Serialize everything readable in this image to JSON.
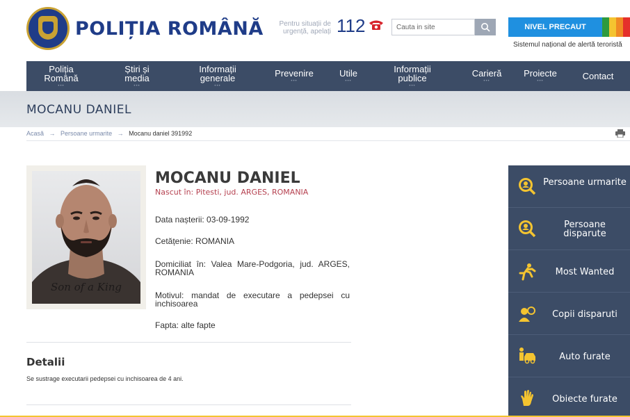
{
  "header": {
    "logo_text": "POLIȚIA ROMÂNĂ",
    "emergency_text": "Pentru situații de urgență, apelați",
    "emergency_number": "112",
    "search_placeholder": "Cauta in site",
    "alert_button": "NIVEL PRECAUT",
    "alert_caption": "Sistemul național de alertă teroristă",
    "alert_colors": [
      "#2e9a3e",
      "#f4c430",
      "#f08a24",
      "#e5302b"
    ]
  },
  "nav": {
    "items": [
      {
        "label": "Poliția Română"
      },
      {
        "label": "Știri și media"
      },
      {
        "label": "Informații generale"
      },
      {
        "label": "Prevenire"
      },
      {
        "label": "Utile"
      },
      {
        "label": "Informații publice"
      },
      {
        "label": "Carieră"
      },
      {
        "label": "Proiecte"
      },
      {
        "label": "Contact"
      }
    ]
  },
  "page": {
    "title": "MOCANU DANIEL"
  },
  "breadcrumb": {
    "home": "Acasă",
    "section": "Persoane urmarite",
    "current": "Mocanu daniel 391992"
  },
  "person": {
    "name": "MOCANU DANIEL",
    "born": "Nascut în: Pitesti, jud. ARGES, ROMANIA",
    "birth_date": "Data nașterii: 03-09-1992",
    "citizenship": "Cetățenie: ROMANIA",
    "residence": "Domiciliat în: Valea Mare-Podgoria, jud. ARGES, ROMANIA",
    "reason": "Motivul: mandat de executare a pedepsei cu inchisoarea",
    "deed": "Fapta: alte fapte",
    "tattoo_text": "Son of a King"
  },
  "details": {
    "title": "Detalii",
    "text": "Se sustrage executarii pedepsei cu inchisoarea de 4 ani."
  },
  "sidebar": {
    "items": [
      {
        "label": "Persoane urmarite",
        "icon": "search-person-icon"
      },
      {
        "label": "Persoane disparute",
        "icon": "search-person-icon"
      },
      {
        "label": "Most Wanted",
        "icon": "running-man-icon"
      },
      {
        "label": "Copii disparuti",
        "icon": "child-icon"
      },
      {
        "label": "Auto furate",
        "icon": "car-thief-icon"
      },
      {
        "label": "Obiecte furate",
        "icon": "hand-icon"
      }
    ]
  }
}
